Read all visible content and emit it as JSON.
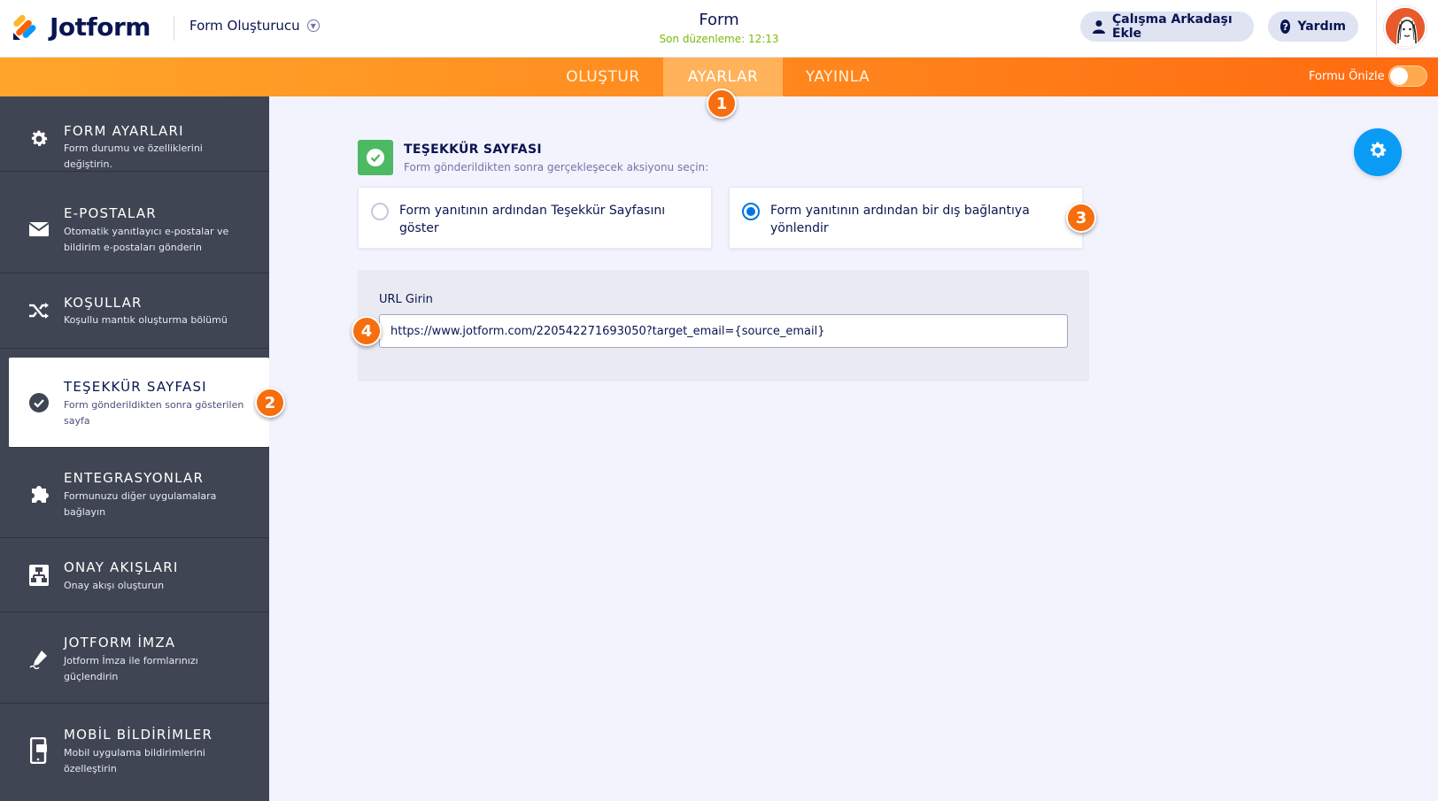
{
  "header": {
    "logo_text": "Jotform",
    "builder_menu": "Form Oluşturucu",
    "form_title": "Form",
    "saved_status": "Son düzenleme: 12:13",
    "collab_button": "Çalışma Arkadaşı Ekle",
    "help_button": "Yardım"
  },
  "tabs": {
    "build": "OLUŞTUR",
    "settings": "AYARLAR",
    "publish": "YAYINLA",
    "preview_label": "Formu Önizle"
  },
  "sidebar": {
    "items": [
      {
        "title": "FORM AYARLARI",
        "desc": "Form durumu ve özelliklerini değiştirin."
      },
      {
        "title": "E-POSTALAR",
        "desc": "Otomatik yanıtlayıcı e-postalar ve bildirim e-postaları gönderin"
      },
      {
        "title": "KOŞULLAR",
        "desc": "Koşullu mantık oluşturma bölümü"
      },
      {
        "title": "TEŞEKKÜR SAYFASI",
        "desc": "Form gönderildikten sonra gösterilen sayfa"
      },
      {
        "title": "ENTEGRASYONLAR",
        "desc": "Formunuzu diğer uygulamalara bağlayın"
      },
      {
        "title": "ONAY AKIŞLARI",
        "desc": "Onay akışı oluşturun"
      },
      {
        "title": "JOTFORM İMZA",
        "desc": "Jotform İmza ile formlarınızı güçlendirin"
      },
      {
        "title": "MOBİL BİLDİRİMLER",
        "desc": "Mobil uygulama bildirimlerini özelleştirin"
      }
    ]
  },
  "main": {
    "section_title": "TEŞEKKÜR SAYFASI",
    "section_subtitle": "Form gönderildikten sonra gerçekleşecek aksiyonu seçin:",
    "option_thankyou": "Form yanıtının ardından Teşekkür Sayfasını göster",
    "option_redirect": "Form yanıtının ardından bir dış bağlantıya yönlendir",
    "selected_option": "option_redirect",
    "url_label": "URL Girin",
    "url_value": "https://www.jotform.com/220542271693050?target_email={source_email}"
  },
  "callouts": {
    "one": "1",
    "two": "2",
    "three": "3",
    "four": "4"
  },
  "colors": {
    "accent_orange": "#ff8a1f",
    "sidebar_bg": "#3f4552",
    "check_green": "#4cb963",
    "radio_blue": "#0075e3",
    "fab_blue": "#0a9bf5",
    "callout_orange": "#f76e0e"
  },
  "icons": {
    "logo": "jotform-logo-icon",
    "builder_chevron": "chevron-down-icon",
    "collab": "user-icon",
    "help": "question-icon",
    "form_settings": "gear-icon",
    "emails": "envelope-icon",
    "conditions": "shuffle-icon",
    "thankyou": "check-circle-icon",
    "integrations": "puzzle-icon",
    "approval": "flow-icon",
    "sign": "pen-icon",
    "mobile": "phone-icon",
    "fab": "gear-icon"
  }
}
